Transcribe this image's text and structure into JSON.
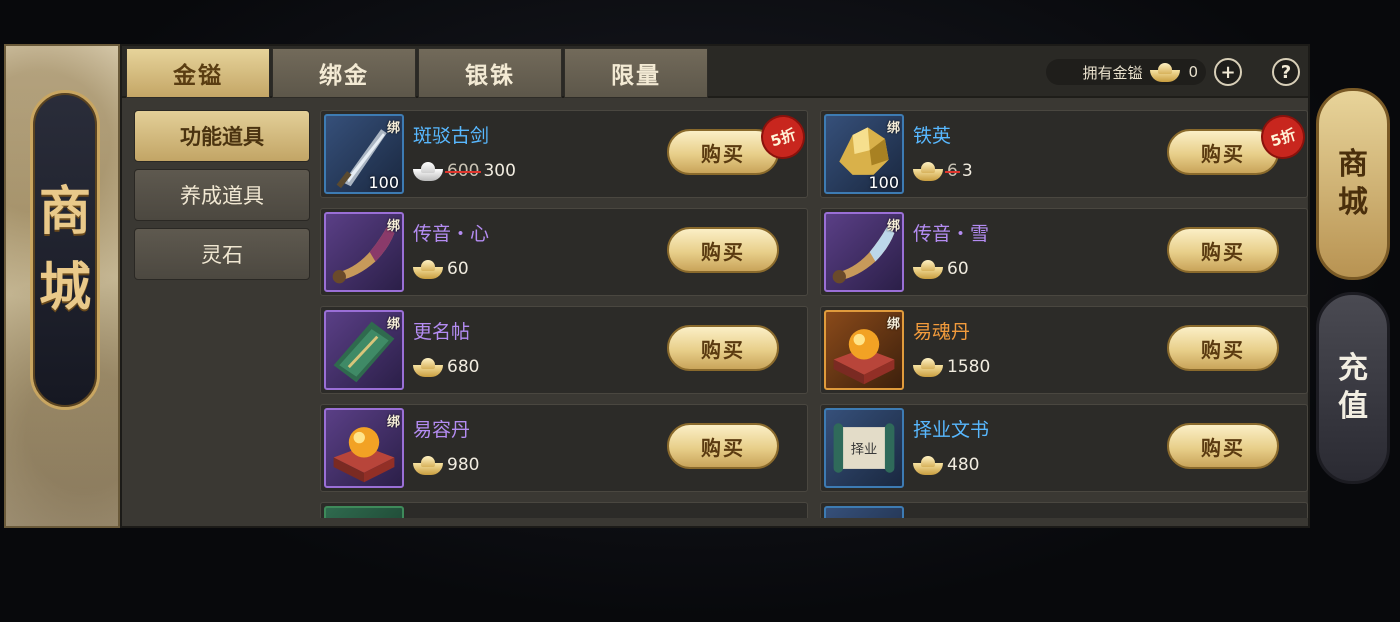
{
  "banner": {
    "title_chars": [
      "商",
      "城"
    ]
  },
  "tabs": [
    {
      "label": "金镒",
      "active": true
    },
    {
      "label": "绑金",
      "active": false
    },
    {
      "label": "银铢",
      "active": false
    },
    {
      "label": "限量",
      "active": false
    }
  ],
  "currency": {
    "label": "拥有金镒",
    "amount": "0",
    "add_icon": "plus-icon",
    "help_icon": "question-icon",
    "help_symbol": "?"
  },
  "categories": [
    {
      "label": "功能道具",
      "active": true
    },
    {
      "label": "养成道具",
      "active": false
    },
    {
      "label": "灵石",
      "active": false
    }
  ],
  "items": [
    {
      "name": "斑驳古剑",
      "rarity": "blue",
      "bind": "绑",
      "qty": "100",
      "old_price": "600",
      "price": "300",
      "price_icon": "silver-ingot-icon",
      "discount": "5折",
      "buy": "购买",
      "icon": "sword-icon"
    },
    {
      "name": "铁英",
      "rarity": "blue",
      "bind": "绑",
      "qty": "100",
      "old_price": "6",
      "price": "3",
      "price_icon": "gold-ingot-icon",
      "discount": "5折",
      "buy": "购买",
      "icon": "ore-icon"
    },
    {
      "name": "传音・心",
      "rarity": "purple",
      "bind": "绑",
      "qty": "",
      "old_price": "",
      "price": "60",
      "price_icon": "gold-ingot-icon",
      "discount": "",
      "buy": "购买",
      "icon": "horn-icon"
    },
    {
      "name": "传音・雪",
      "rarity": "purple",
      "bind": "绑",
      "qty": "",
      "old_price": "",
      "price": "60",
      "price_icon": "gold-ingot-icon",
      "discount": "",
      "buy": "购买",
      "icon": "horn-icon"
    },
    {
      "name": "更名帖",
      "rarity": "purple",
      "bind": "绑",
      "qty": "",
      "old_price": "",
      "price": "680",
      "price_icon": "gold-ingot-icon",
      "discount": "",
      "buy": "购买",
      "icon": "card-icon"
    },
    {
      "name": "易魂丹",
      "rarity": "orange",
      "bind": "绑",
      "qty": "",
      "old_price": "",
      "price": "1580",
      "price_icon": "gold-ingot-icon",
      "discount": "",
      "buy": "购买",
      "icon": "pill-box-icon"
    },
    {
      "name": "易容丹",
      "rarity": "purple",
      "bind": "绑",
      "qty": "",
      "old_price": "",
      "price": "980",
      "price_icon": "gold-ingot-icon",
      "discount": "",
      "buy": "购买",
      "icon": "pill-box-icon"
    },
    {
      "name": "择业文书",
      "rarity": "blue",
      "bind": "绑",
      "qty": "",
      "old_price": "",
      "price": "480",
      "price_icon": "gold-ingot-icon",
      "discount": "",
      "buy": "购买",
      "icon": "scroll-icon",
      "scroll_text": "择业"
    }
  ],
  "side_tabs": [
    {
      "chars": [
        "商",
        "城"
      ],
      "active": true
    },
    {
      "chars": [
        "充",
        "值"
      ],
      "active": false
    }
  ]
}
